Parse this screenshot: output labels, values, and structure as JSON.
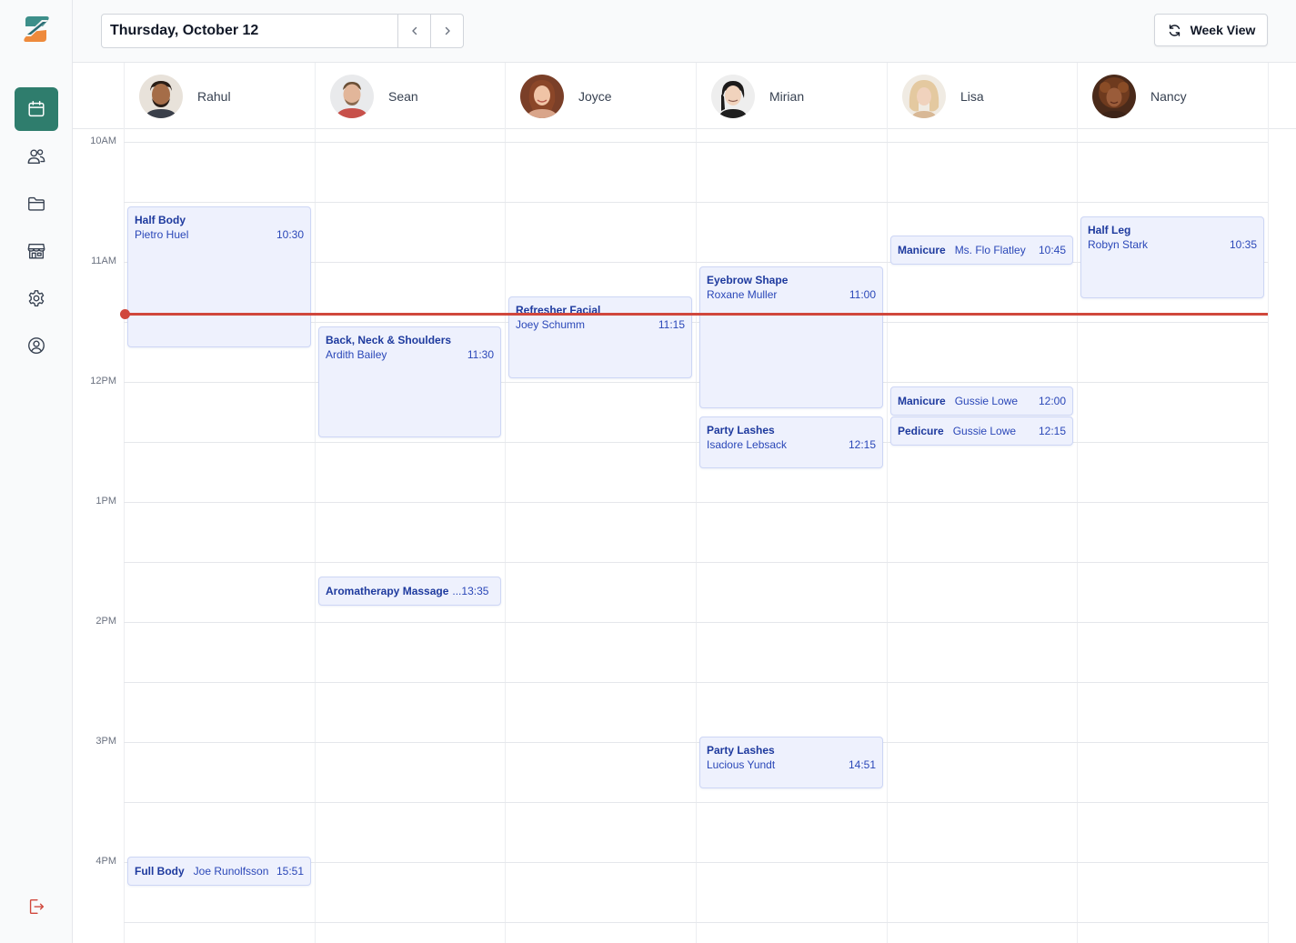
{
  "header": {
    "date": "Thursday, October 12",
    "view_button": "Week View"
  },
  "sidebar": {
    "items": [
      {
        "icon": "calendar-icon",
        "active": true
      },
      {
        "icon": "users-icon",
        "active": false
      },
      {
        "icon": "folder-icon",
        "active": false
      },
      {
        "icon": "store-icon",
        "active": false
      },
      {
        "icon": "gear-icon",
        "active": false
      },
      {
        "icon": "user-circle-icon",
        "active": false
      }
    ],
    "logout_icon": "logout-icon"
  },
  "staff": [
    {
      "name": "Rahul"
    },
    {
      "name": "Sean"
    },
    {
      "name": "Joyce"
    },
    {
      "name": "Mirian"
    },
    {
      "name": "Lisa"
    },
    {
      "name": "Nancy"
    }
  ],
  "hours": [
    "10AM",
    "11AM",
    "12PM",
    "1PM",
    "2PM",
    "3PM",
    "4PM"
  ],
  "appointments": [
    {
      "staff": "Rahul",
      "service": "Half Body",
      "client": "Pietro Huel",
      "time": "10:30"
    },
    {
      "staff": "Rahul",
      "service": "Full Body",
      "client": "Joe Runolfsson",
      "time": "15:51"
    },
    {
      "staff": "Sean",
      "service": "Back, Neck & Shoulders",
      "client": "Ardith Bailey",
      "time": "11:30"
    },
    {
      "staff": "Sean",
      "service": "Aromatherapy Massage",
      "client": "...",
      "time": "13:35"
    },
    {
      "staff": "Joyce",
      "service": "Refresher Facial",
      "client": "Joey Schumm",
      "time": "11:15"
    },
    {
      "staff": "Mirian",
      "service": "Eyebrow Shape",
      "client": "Roxane Muller",
      "time": "11:00"
    },
    {
      "staff": "Mirian",
      "service": "Party Lashes",
      "client": "Isadore Lebsack",
      "time": "12:15"
    },
    {
      "staff": "Mirian",
      "service": "Party Lashes",
      "client": "Lucious Yundt",
      "time": "14:51"
    },
    {
      "staff": "Lisa",
      "service": "Manicure",
      "client": "Ms. Flo Flatley",
      "time": "10:45"
    },
    {
      "staff": "Lisa",
      "service": "Manicure",
      "client": "Gussie Lowe",
      "time": "12:00"
    },
    {
      "staff": "Lisa",
      "service": "Pedicure",
      "client": "Gussie Lowe",
      "time": "12:15"
    },
    {
      "staff": "Nancy",
      "service": "Half Leg",
      "client": "Robyn Stark",
      "time": "10:35"
    }
  ],
  "colors": {
    "brand": "#2f7d6d",
    "now_line": "#d0473c",
    "appointment_bg": "#eef1fd",
    "appointment_text": "#1e3a9e"
  }
}
